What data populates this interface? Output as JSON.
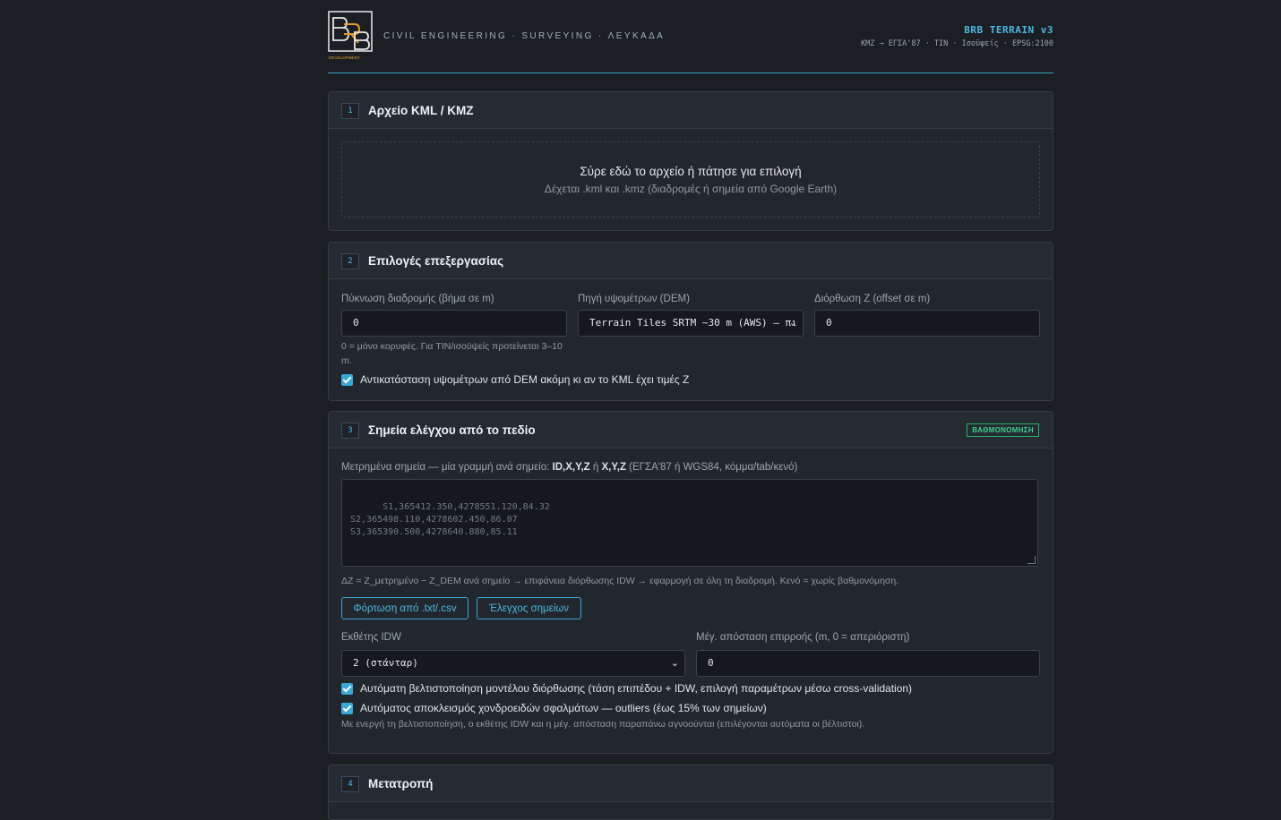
{
  "header": {
    "logo_text": "BRB",
    "logo_caption": "DEVELOPMENT",
    "tagline": "CIVIL ENGINEERING · SURVEYING · ΛΕΥΚΑΔΑ",
    "app_title": "BRB TERRAIN v3",
    "app_subtitle": "KMZ → ΕΓΣΑ'87 · TIN · Ισοϋψείς · EPSG:2100"
  },
  "colors": {
    "accent": "#3aa8d6",
    "badge": "#3fd089",
    "background": "#1b1f24"
  },
  "step1": {
    "number": "1",
    "title": "Αρχείο KML / KMZ",
    "drop_main": "Σύρε εδώ το αρχείο ή πάτησε για επιλογή",
    "drop_sub": "Δέχεται .kml και .kmz (διαδρομές ή σημεία από Google Earth)"
  },
  "step2": {
    "number": "2",
    "title": "Επιλογές επεξεργασίας",
    "densify_label": "Πύκνωση διαδρομής (βήμα σε m)",
    "densify_value": "0",
    "densify_hint": "0 = μόνο κορυφές. Για TIN/ισοϋψείς προτείνεται 3–10 m.",
    "dem_label": "Πηγή υψομέτρων (DEM)",
    "dem_value": "Terrain Tiles SRTM ~30 m (AWS) — πι",
    "offset_label": "Διόρθωση Z (offset σε m)",
    "offset_value": "0",
    "replace_label": "Αντικατάσταση υψομέτρων από DEM ακόμη κι αν το KML έχει τιμές Z",
    "replace_checked": true
  },
  "step3": {
    "number": "3",
    "title": "Σημεία ελέγχου από το πεδίο",
    "badge": "ΒΑΘΜΟΝΟΜΗΣΗ",
    "points_label_pre": "Μετρημένα σημεία — μία γραμμή ανά σημείο: ",
    "points_label_fmt1": "ID,X,Y,Z",
    "points_label_or": " ή ",
    "points_label_fmt2": "X,Y,Z",
    "points_label_post": " (ΕΓΣΑ'87 ή WGS84, κόμμα/tab/κενό)",
    "points_placeholder": "S1,365412.350,4278551.120,84.32\nS2,365498.110,4278602.450,86.07\nS3,365390.500,4278640.880,85.11",
    "formula_hint": "ΔZ = Z_μετρημένο − Z_DEM ανά σημείο → επιφάνεια διόρθωσης IDW → εφαρμογή σε όλη τη διαδρομή. Κενό = χωρίς βαθμονόμηση.",
    "load_button": "Φόρτωση από .txt/.csv",
    "check_button": "Έλεγχος σημείων",
    "idw_label": "Εκθέτης IDW",
    "idw_value": "2 (στάνταρ)",
    "maxdist_label": "Μέγ. απόσταση επιρροής (m, 0 = απεριόριστη)",
    "maxdist_value": "0",
    "auto_opt_label": "Αυτόματη βελτιστοποίηση μοντέλου διόρθωσης (τάση επιπέδου + IDW, επιλογή παραμέτρων μέσω cross-validation)",
    "auto_opt_checked": true,
    "outliers_label": "Αυτόματος αποκλεισμός χονδροειδών σφαλμάτων — outliers (έως 15% των σημείων)",
    "outliers_checked": true,
    "opt_hint": "Με ενεργή τη βελτιστοποίηση, ο εκθέτης IDW και η μέγ. απόσταση παραπάνω αγνοούνται (επιλέγονται αυτόματα οι βέλτιστοι)."
  },
  "step4": {
    "number": "4",
    "title": "Μετατροπή"
  }
}
